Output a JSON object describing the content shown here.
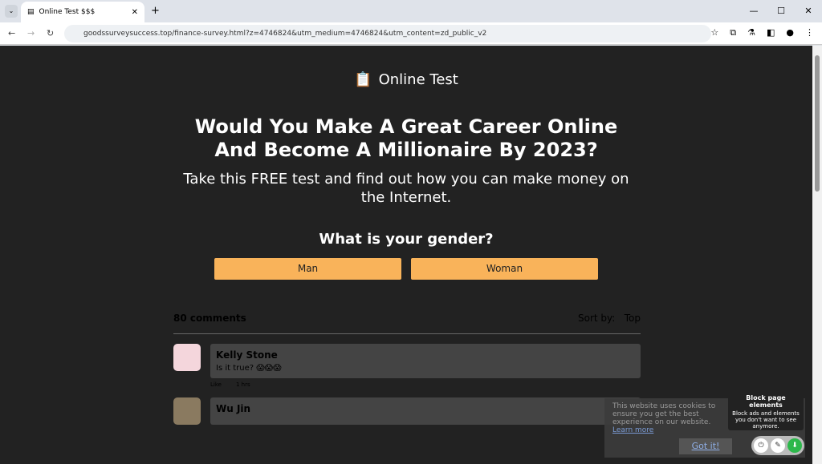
{
  "browser": {
    "tab_title": "Online Test $$$",
    "url": "goodssurveysuccess.top/finance-survey.html?z=4746824&utm_medium=4746824&utm_content=zd_public_v2"
  },
  "page": {
    "logo_text": "Online Test",
    "headline": "Would You Make A Great Career Online And Become A Millionaire By 2023?",
    "subheadline": "Take this FREE test and find out how you can make money on the Internet.",
    "question": "What is your gender?",
    "options": [
      "Man",
      "Woman"
    ],
    "button_color": "#f9b35a"
  },
  "comments": {
    "count_label": "80 comments",
    "sort_label": "Sort by:",
    "sort_value": "Top",
    "items": [
      {
        "name": "Kelly Stone",
        "text": "Is it true? 😱😱😱",
        "like": "Like",
        "time": "1 hrs"
      },
      {
        "name": "Wu Jin"
      }
    ]
  },
  "cookie": {
    "text": "This website uses cookies to ensure you get the best experience on our website.",
    "link": "Learn more",
    "button": "Got it!"
  },
  "tooltip": {
    "title": "Block page elements",
    "body": "Block ads and elements you don't want to see anymore."
  }
}
